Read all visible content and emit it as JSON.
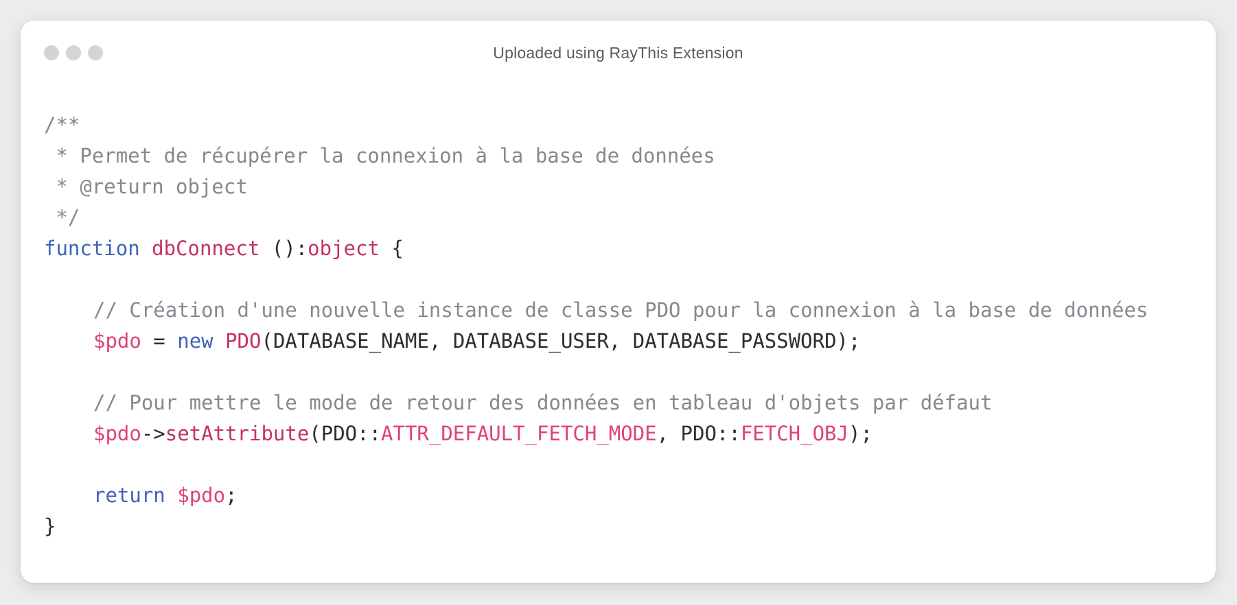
{
  "window": {
    "title": "Uploaded using RayThis Extension",
    "traffic_lights": [
      "close",
      "minimize",
      "maximize"
    ]
  },
  "code": {
    "lines": [
      {
        "segments": [
          {
            "t": "/**",
            "k": "comment"
          }
        ]
      },
      {
        "segments": [
          {
            "t": " * Permet de récupérer la connexion à la base de données",
            "k": "comment"
          }
        ]
      },
      {
        "segments": [
          {
            "t": " * @return object",
            "k": "comment"
          }
        ]
      },
      {
        "segments": [
          {
            "t": " */",
            "k": "comment"
          }
        ]
      },
      {
        "segments": [
          {
            "t": "function",
            "k": "keyword"
          },
          {
            "t": " ",
            "k": "plain"
          },
          {
            "t": "dbConnect",
            "k": "func"
          },
          {
            "t": " ():",
            "k": "plain"
          },
          {
            "t": "object",
            "k": "type"
          },
          {
            "t": " {",
            "k": "plain"
          }
        ]
      },
      {
        "segments": []
      },
      {
        "indent": 1,
        "segments": [
          {
            "t": "// Création d'une nouvelle instance de classe PDO pour la connexion à la base de données",
            "k": "comment"
          }
        ]
      },
      {
        "indent": 1,
        "segments": [
          {
            "t": "$pdo",
            "k": "var"
          },
          {
            "t": " = ",
            "k": "plain"
          },
          {
            "t": "new",
            "k": "keyword"
          },
          {
            "t": " ",
            "k": "plain"
          },
          {
            "t": "PDO",
            "k": "func"
          },
          {
            "t": "(DATABASE_NAME, DATABASE_USER, DATABASE_PASSWORD);",
            "k": "plain"
          }
        ]
      },
      {
        "segments": []
      },
      {
        "indent": 1,
        "segments": [
          {
            "t": "// Pour mettre le mode de retour des données en tableau d'objets par défaut",
            "k": "comment"
          }
        ]
      },
      {
        "indent": 1,
        "segments": [
          {
            "t": "$pdo",
            "k": "var"
          },
          {
            "t": "->",
            "k": "plain"
          },
          {
            "t": "setAttribute",
            "k": "func"
          },
          {
            "t": "(PDO::",
            "k": "plain"
          },
          {
            "t": "ATTR_DEFAULT_FETCH_MODE",
            "k": "const"
          },
          {
            "t": ", PDO::",
            "k": "plain"
          },
          {
            "t": "FETCH_OBJ",
            "k": "const"
          },
          {
            "t": ");",
            "k": "plain"
          }
        ]
      },
      {
        "segments": []
      },
      {
        "indent": 1,
        "segments": [
          {
            "t": "return",
            "k": "keyword"
          },
          {
            "t": " ",
            "k": "plain"
          },
          {
            "t": "$pdo",
            "k": "var"
          },
          {
            "t": ";",
            "k": "plain"
          }
        ]
      },
      {
        "segments": [
          {
            "t": "}",
            "k": "plain"
          }
        ]
      }
    ]
  },
  "colors": {
    "comment": "#8a8690",
    "keyword": "#3f63b8",
    "function": "#c4325f",
    "variable": "#e0417b",
    "plain": "#2d2d2d",
    "traffic_light": "#d4d4d4"
  }
}
